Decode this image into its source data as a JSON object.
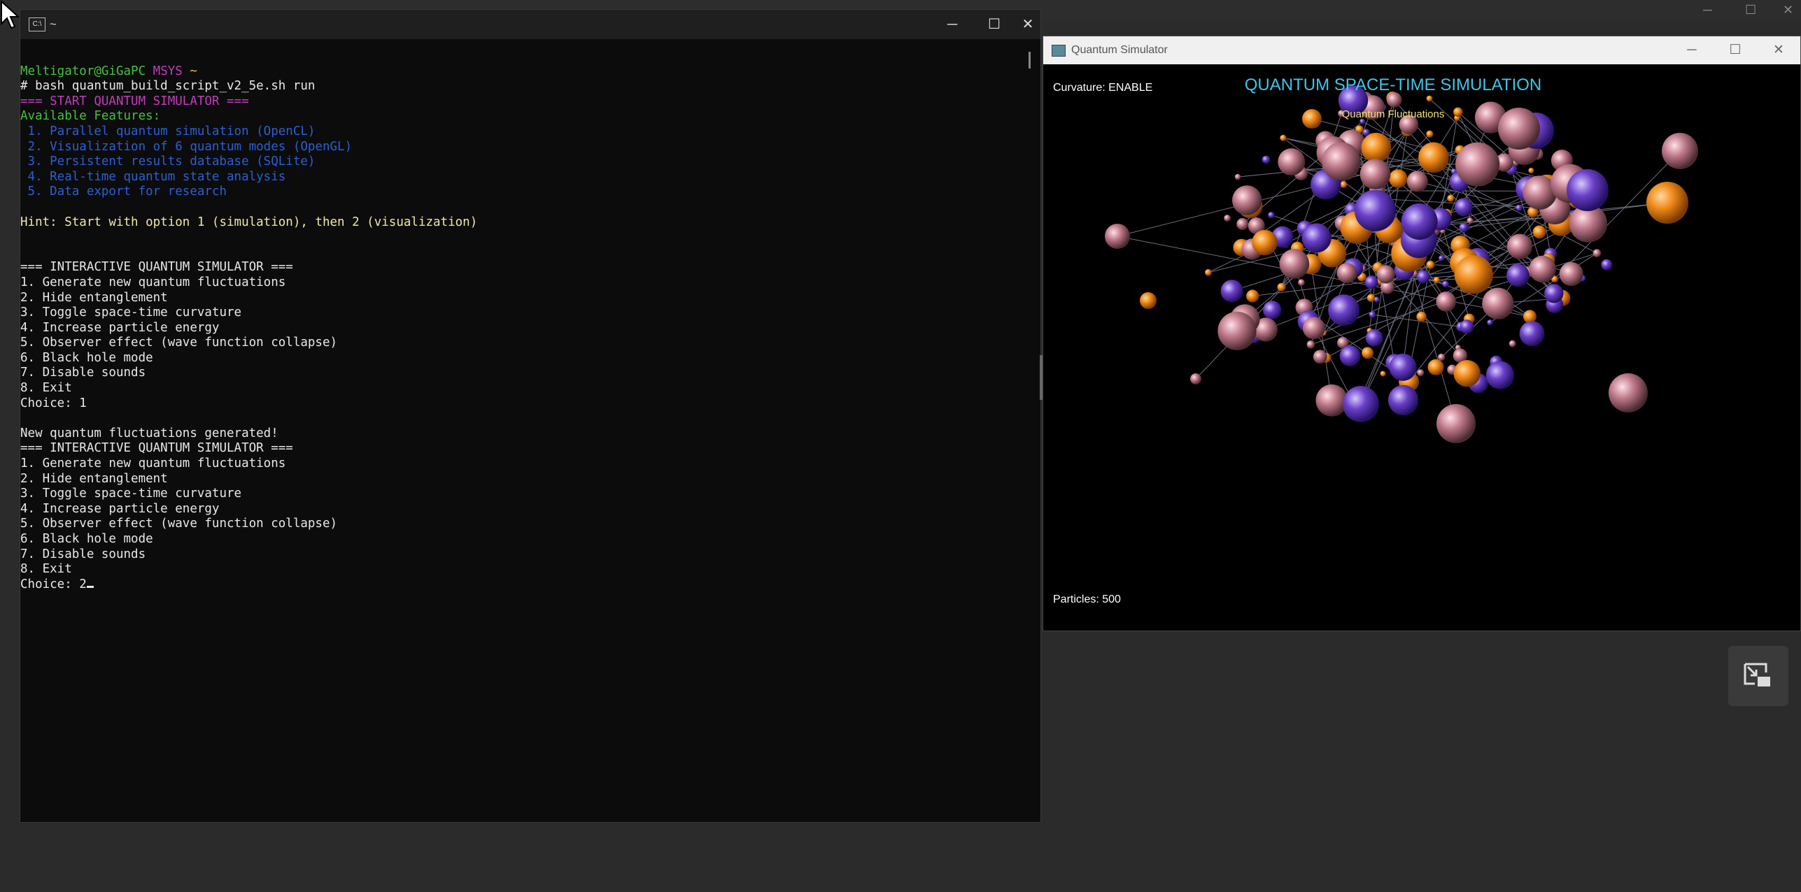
{
  "terminal": {
    "title": "~",
    "lines": [
      {
        "segs": [
          {
            "t": "",
            "c": "white"
          }
        ]
      },
      {
        "segs": [
          {
            "t": "Meltigator@GiGaPC ",
            "c": "green"
          },
          {
            "t": "MSYS ",
            "c": "purple"
          },
          {
            "t": "~",
            "c": "yellow"
          }
        ]
      },
      {
        "segs": [
          {
            "t": "# bash quantum_build_script_v2_5e.sh run",
            "c": "white"
          }
        ]
      },
      {
        "segs": [
          {
            "t": "=== START QUANTUM SIMULATOR ===",
            "c": "purple"
          }
        ]
      },
      {
        "segs": [
          {
            "t": "Available Features:",
            "c": "green"
          }
        ]
      },
      {
        "segs": [
          {
            "t": " 1. Parallel quantum simulation (OpenCL)",
            "c": "blue"
          }
        ]
      },
      {
        "segs": [
          {
            "t": " 2. Visualization of 6 quantum modes (OpenGL)",
            "c": "blue"
          }
        ]
      },
      {
        "segs": [
          {
            "t": " 3. Persistent results database (SQLite)",
            "c": "blue"
          }
        ]
      },
      {
        "segs": [
          {
            "t": " 4. Real-time quantum state analysis",
            "c": "blue"
          }
        ]
      },
      {
        "segs": [
          {
            "t": " 5. Data export for research",
            "c": "blue"
          }
        ]
      },
      {
        "segs": [
          {
            "t": "",
            "c": "white"
          }
        ]
      },
      {
        "segs": [
          {
            "t": "Hint: Start with option 1 (simulation), then 2 (visualization)",
            "c": "hint"
          }
        ]
      },
      {
        "segs": [
          {
            "t": "",
            "c": "white"
          }
        ]
      },
      {
        "segs": [
          {
            "t": "",
            "c": "white"
          }
        ]
      },
      {
        "segs": [
          {
            "t": "=== INTERACTIVE QUANTUM SIMULATOR ===",
            "c": "white"
          }
        ]
      },
      {
        "segs": [
          {
            "t": "1. Generate new quantum fluctuations",
            "c": "white"
          }
        ]
      },
      {
        "segs": [
          {
            "t": "2. Hide entanglement",
            "c": "white"
          }
        ]
      },
      {
        "segs": [
          {
            "t": "3. Toggle space-time curvature",
            "c": "white"
          }
        ]
      },
      {
        "segs": [
          {
            "t": "4. Increase particle energy",
            "c": "white"
          }
        ]
      },
      {
        "segs": [
          {
            "t": "5. Observer effect (wave function collapse)",
            "c": "white"
          }
        ]
      },
      {
        "segs": [
          {
            "t": "6. Black hole mode",
            "c": "white"
          }
        ]
      },
      {
        "segs": [
          {
            "t": "7. Disable sounds",
            "c": "white"
          }
        ]
      },
      {
        "segs": [
          {
            "t": "8. Exit",
            "c": "white"
          }
        ]
      },
      {
        "segs": [
          {
            "t": "Choice: 1",
            "c": "white"
          }
        ]
      },
      {
        "segs": [
          {
            "t": "",
            "c": "white"
          }
        ]
      },
      {
        "segs": [
          {
            "t": "New quantum fluctuations generated!",
            "c": "white"
          }
        ]
      },
      {
        "segs": [
          {
            "t": "=== INTERACTIVE QUANTUM SIMULATOR ===",
            "c": "white"
          }
        ]
      },
      {
        "segs": [
          {
            "t": "1. Generate new quantum fluctuations",
            "c": "white"
          }
        ]
      },
      {
        "segs": [
          {
            "t": "2. Hide entanglement",
            "c": "white"
          }
        ]
      },
      {
        "segs": [
          {
            "t": "3. Toggle space-time curvature",
            "c": "white"
          }
        ]
      },
      {
        "segs": [
          {
            "t": "4. Increase particle energy",
            "c": "white"
          }
        ]
      },
      {
        "segs": [
          {
            "t": "5. Observer effect (wave function collapse)",
            "c": "white"
          }
        ]
      },
      {
        "segs": [
          {
            "t": "6. Black hole mode",
            "c": "white"
          }
        ]
      },
      {
        "segs": [
          {
            "t": "7. Disable sounds",
            "c": "white"
          }
        ]
      },
      {
        "segs": [
          {
            "t": "8. Exit",
            "c": "white"
          }
        ]
      }
    ],
    "prompt": "Choice: 2",
    "colors": {
      "green": "#45c23b",
      "purple": "#c23bbf",
      "yellow": "#e0c245",
      "blue": "#2a5fd6",
      "hint": "#f0e6a8",
      "text": "#e8e8e8"
    }
  },
  "simulator": {
    "window_title": "Quantum Simulator",
    "curvature": "Curvature: ENABLE",
    "title": "QUANTUM SPACE-TIME SIMULATION",
    "mode": "Quantum Fluctuations",
    "particles": "Particles: 500",
    "colors": {
      "title": "#3ec6e8",
      "mode": "#f2e27a",
      "orange": "#f08a1a",
      "violet": "#6a40c8",
      "pink": "#c07a8a"
    }
  },
  "window_controls": {
    "minimize": "─",
    "maximize": "☐",
    "close": "✕"
  }
}
